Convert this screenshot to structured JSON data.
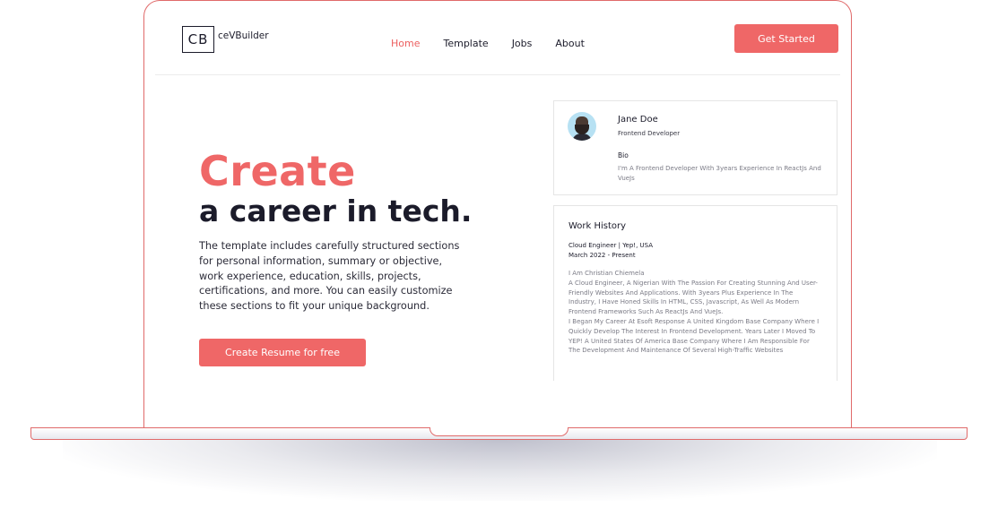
{
  "nav": {
    "logo_mark": "CB",
    "logo_text": "ceVBuilder",
    "items": [
      {
        "label": "Home",
        "active": true
      },
      {
        "label": "Template",
        "active": false
      },
      {
        "label": "Jobs",
        "active": false
      },
      {
        "label": "About",
        "active": false
      }
    ],
    "cta_label": "Get Started"
  },
  "hero": {
    "title_line1": "Create",
    "title_line2": "a career in tech.",
    "description": "The template includes carefully structured sections for personal information, summary or objective, work experience, education, skills, projects, certifications, and more. You can easily customize these sections to fit your unique background.",
    "cta_label": "Create Resume for free"
  },
  "profile": {
    "avatar_icon": "user-avatar-icon",
    "name": "Jane Doe",
    "role": "Frontend Developer",
    "bio_heading": "Bio",
    "bio": "I'm A Frontend Developer With 3years Experience In ReactJs And VueJs"
  },
  "work_history": {
    "title": "Work History",
    "job": "Cloud Engineer | Yep!, USA",
    "dates": "March 2022 - Present",
    "paragraphs": [
      "I Am Christian Chiemela",
      "A Cloud Engineer, A Nigerian With The Passion For Creating Stunning And User-Friendly Websites And Applications. With 3years Plus Experience In The Industry, I Have Honed Skills In HTML, CSS, Javascript, As Well As Modern Frontend Frameworks Such As ReactJs And VueJs.",
      "I Began My Career At Esoft Response A United Kingdom Base Company Where I Quickly Develop The Interest In Frontend Development. Years Later I Moved To YEP! A United States Of America Base Company Where I Am Responsible For The Development And Maintenance Of Several High-Traffic Websites"
    ]
  },
  "colors": {
    "accent": "#ef6767",
    "text_dark": "#1b1b2a",
    "text_muted": "#7b7b86",
    "avatar_bg": "#b7e1f3"
  }
}
